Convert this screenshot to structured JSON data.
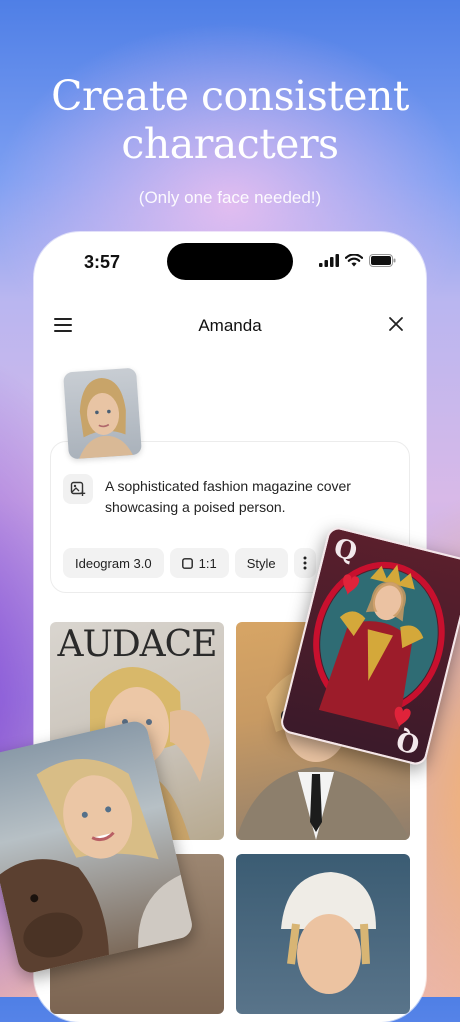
{
  "headline": {
    "line1": "Create consistent",
    "line2": "characters"
  },
  "subheadline": "(Only one face needed!)",
  "status_bar": {
    "time": "3:57"
  },
  "nav": {
    "title": "Amanda"
  },
  "prompt": {
    "text": "A sophisticated fashion magazine cover showcasing a poised person."
  },
  "chips": {
    "model": "Ideogram 3.0",
    "ratio": "1:1",
    "style": "Style"
  },
  "gallery": {
    "magazine_masthead": "AUDACE"
  },
  "playing_card": {
    "rank": "Q"
  },
  "colors": {
    "accent_red": "#c8102e",
    "card_back": "#3b1a2a",
    "chip_bg": "#f2f2f2"
  }
}
